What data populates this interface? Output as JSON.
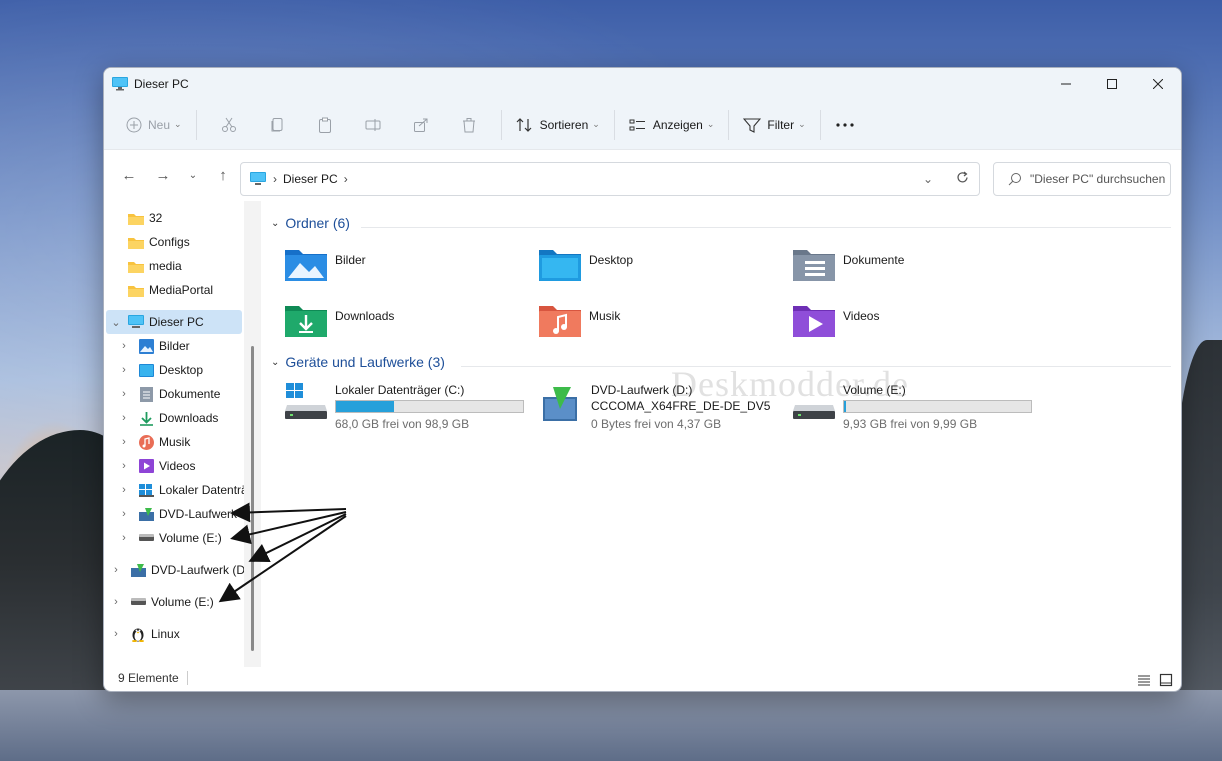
{
  "window": {
    "title": "Dieser PC"
  },
  "commandbar": {
    "new_label": "Neu",
    "sort_label": "Sortieren",
    "view_label": "Anzeigen",
    "filter_label": "Filter",
    "more_label": "..."
  },
  "address": {
    "path_label": "Dieser PC",
    "search_placeholder": "\"Dieser PC\" durchsuchen"
  },
  "sidebar": {
    "items": [
      {
        "label": "32"
      },
      {
        "label": "Configs"
      },
      {
        "label": "media"
      },
      {
        "label": "MediaPortal"
      },
      {
        "label": "Dieser PC"
      },
      {
        "label": "Bilder"
      },
      {
        "label": "Desktop"
      },
      {
        "label": "Dokumente"
      },
      {
        "label": "Downloads"
      },
      {
        "label": "Musik"
      },
      {
        "label": "Videos"
      },
      {
        "label": "Lokaler Datenträ"
      },
      {
        "label": "DVD-Laufwerk"
      },
      {
        "label": "Volume (E:)"
      },
      {
        "label": "DVD-Laufwerk (D:"
      },
      {
        "label": "Volume (E:)"
      },
      {
        "label": "Linux"
      }
    ]
  },
  "content": {
    "folders_heading": "Ordner (6)",
    "folders": [
      {
        "name": "Bilder"
      },
      {
        "name": "Desktop"
      },
      {
        "name": "Dokumente"
      },
      {
        "name": "Downloads"
      },
      {
        "name": "Musik"
      },
      {
        "name": "Videos"
      }
    ],
    "drives_heading": "Geräte und Laufwerke (3)",
    "drives": [
      {
        "name": "Lokaler Datenträger (C:)",
        "sub": "68,0 GB frei von 98,9 GB",
        "used_fraction": 0.31
      },
      {
        "name": "DVD-Laufwerk (D:)",
        "line2": "CCCOMA_X64FRE_DE-DE_DV5",
        "sub": "0 Bytes frei von 4,37 GB"
      },
      {
        "name": "Volume (E:)",
        "sub": "9,93 GB frei von 9,99 GB",
        "used_fraction": 0.006
      }
    ],
    "watermark": "Deskmodder.de"
  },
  "status": {
    "count": "9 Elemente"
  },
  "colors": {
    "accent": "#26a0da",
    "heading": "#1e4f99",
    "selection": "#cde3f7"
  }
}
